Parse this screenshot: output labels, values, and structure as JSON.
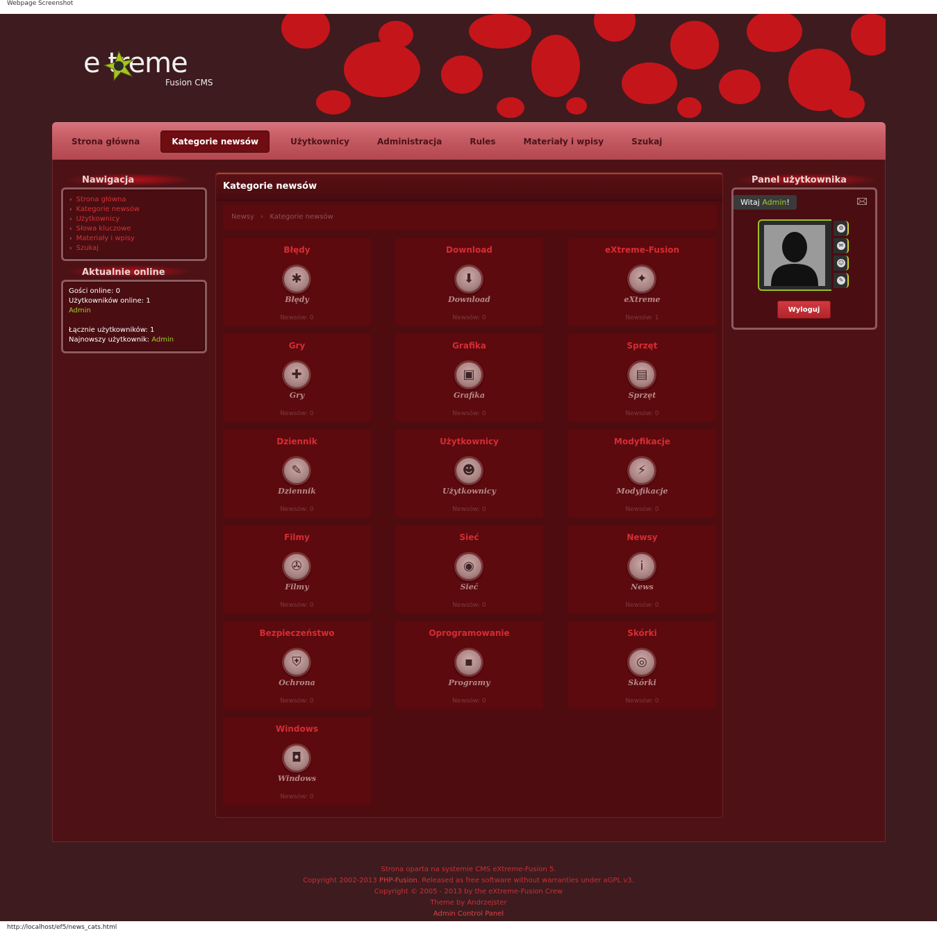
{
  "browser": {
    "top_caption": "Webpage Screenshot",
    "url": "http://localhost/ef5/news_cats.html"
  },
  "logo": {
    "text": "e treme",
    "sub": "Fusion CMS"
  },
  "nav": {
    "items": [
      {
        "label": "Strona główna",
        "active": false
      },
      {
        "label": "Kategorie newsów",
        "active": true
      },
      {
        "label": "Użytkownicy",
        "active": false
      },
      {
        "label": "Administracja",
        "active": false
      },
      {
        "label": "Rules",
        "active": false
      },
      {
        "label": "Materiały i wpisy",
        "active": false
      },
      {
        "label": "Szukaj",
        "active": false
      }
    ]
  },
  "sidebar": {
    "nav_title": "Nawigacja",
    "nav_links": [
      "Strona główna",
      "Kategorie newsów",
      "Użytkownicy",
      "Słowa kluczowe",
      "Materiały i wpisy",
      "Szukaj"
    ],
    "online_title": "Aktualnie online",
    "guests": "Gości online: 0",
    "users_online": "Użytkowników online: 1",
    "online_user": "Admin",
    "total_users": "Łącznie użytkowników: 1",
    "newest_label": "Najnowszy użytkownik:",
    "newest_user": "Admin"
  },
  "main": {
    "title": "Kategorie newsów",
    "breadcrumb": [
      "Newsy",
      "Kategorie newsów"
    ],
    "categories": [
      {
        "title": "Błędy",
        "label": "Błędy",
        "count": "Newsów: 0",
        "icon": "bug-icon",
        "glyph": "✱"
      },
      {
        "title": "Download",
        "label": "Download",
        "count": "Newsów: 0",
        "icon": "download-icon",
        "glyph": "⬇"
      },
      {
        "title": "eXtreme-Fusion",
        "label": "eXtreme",
        "count": "Newsów: 1",
        "icon": "extreme-icon",
        "glyph": "✦"
      },
      {
        "title": "Gry",
        "label": "Gry",
        "count": "Newsów: 0",
        "icon": "gamepad-icon",
        "glyph": "✚"
      },
      {
        "title": "Grafika",
        "label": "Grafika",
        "count": "Newsów: 0",
        "icon": "image-icon",
        "glyph": "▣"
      },
      {
        "title": "Sprzęt",
        "label": "Sprzęt",
        "count": "Newsów: 0",
        "icon": "hardware-icon",
        "glyph": "▤"
      },
      {
        "title": "Dziennik",
        "label": "Dziennik",
        "count": "Newsów: 0",
        "icon": "microphone-icon",
        "glyph": "✎"
      },
      {
        "title": "Użytkownicy",
        "label": "Użytkownicy",
        "count": "Newsów: 0",
        "icon": "user-icon",
        "glyph": "☻"
      },
      {
        "title": "Modyfikacje",
        "label": "Modyfikacje",
        "count": "Newsów: 0",
        "icon": "plug-icon",
        "glyph": "⚡"
      },
      {
        "title": "Filmy",
        "label": "Filmy",
        "count": "Newsów: 0",
        "icon": "film-reel-icon",
        "glyph": "✇"
      },
      {
        "title": "Sieć",
        "label": "Sieć",
        "count": "Newsów: 0",
        "icon": "globe-icon",
        "glyph": "◉"
      },
      {
        "title": "Newsy",
        "label": "News",
        "count": "Newsów: 0",
        "icon": "info-icon",
        "glyph": "i"
      },
      {
        "title": "Bezpieczeństwo",
        "label": "Ochrona",
        "count": "Newsów: 0",
        "icon": "shield-icon",
        "glyph": "⛨"
      },
      {
        "title": "Oprogramowanie",
        "label": "Programy",
        "count": "Newsów: 0",
        "icon": "floppy-icon",
        "glyph": "▪"
      },
      {
        "title": "Skórki",
        "label": "Skórki",
        "count": "Newsów: 0",
        "icon": "swirl-icon",
        "glyph": "◎"
      },
      {
        "title": "Windows",
        "label": "Windows",
        "count": "Newsów: 0",
        "icon": "window-icon",
        "glyph": "◘"
      }
    ]
  },
  "user_panel": {
    "title": "Panel użytkownika",
    "welcome_prefix": "Witaj ",
    "welcome_user": "Admin",
    "welcome_suffix": "!",
    "logout": "Wyloguj",
    "side_buttons": [
      "settings-icon",
      "mail-icon",
      "profile-icon",
      "admin-tools-icon"
    ],
    "side_glyphs": [
      "⚙",
      "✉",
      "☺",
      "✎"
    ]
  },
  "footer": {
    "line1": "Strona oparta na systemie CMS eXtreme-Fusion 5.",
    "line2_prefix": "Copyright 2002-2013 ",
    "line2_link": "PHP-Fusion",
    "line2_suffix": ". Released as free software without warranties under aGPL v3.",
    "line3": "Copyright © 2005 - 2013 by the eXtreme-Fusion Crew",
    "line4": "Theme by Andrzejster",
    "line5": "Admin Control Panel"
  },
  "colors": {
    "background": "#3e1b1e",
    "accent_red": "#d62c34",
    "accent_green": "#9fcb2d",
    "navbar": "#c45a62"
  }
}
